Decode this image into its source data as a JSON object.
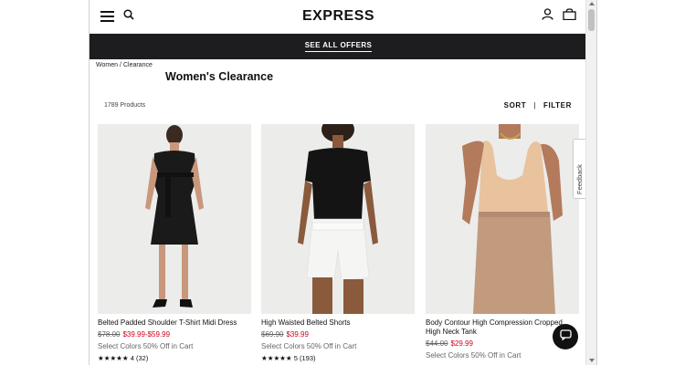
{
  "header": {
    "brand": "EXPRESS",
    "menu_icon": "hamburger-menu-icon",
    "search_icon": "search-icon",
    "account_icon": "user-icon",
    "bag_icon": "shopping-bag-icon"
  },
  "promo_bar": {
    "label": "SEE ALL OFFERS"
  },
  "breadcrumb": {
    "items": [
      "Women",
      "Clearance"
    ],
    "separator": "/"
  },
  "page": {
    "title": "Women's Clearance",
    "product_count": "1789 Products",
    "sort_label": "SORT",
    "filter_label": "FILTER",
    "divider": "|"
  },
  "products": [
    {
      "name": "Belted Padded Shoulder T-Shirt Midi Dress",
      "was_price": "$78.00",
      "now_price": "$39.99-$59.99",
      "promo": "Select Colors 50% Off in Cart",
      "stars": "★★★★★",
      "reviews": "4 (32)"
    },
    {
      "name": "High Waisted Belted Shorts",
      "was_price": "$69.90",
      "now_price": "$39.99",
      "promo": "Select Colors 50% Off in Cart",
      "stars": "★★★★★",
      "reviews": "5 (193)"
    },
    {
      "name": "Body Contour High Compression Cropped High Neck Tank",
      "was_price": "$44.00",
      "now_price": "$29.99",
      "promo": "Select Colors 50% Off in Cart"
    }
  ],
  "feedback": {
    "label": "Feedback"
  },
  "chat": {
    "icon": "chat-bubble-icon"
  },
  "colors": {
    "offers_bar": "#1d1d20",
    "sale_price": "#d0021b",
    "text": "#111111"
  }
}
